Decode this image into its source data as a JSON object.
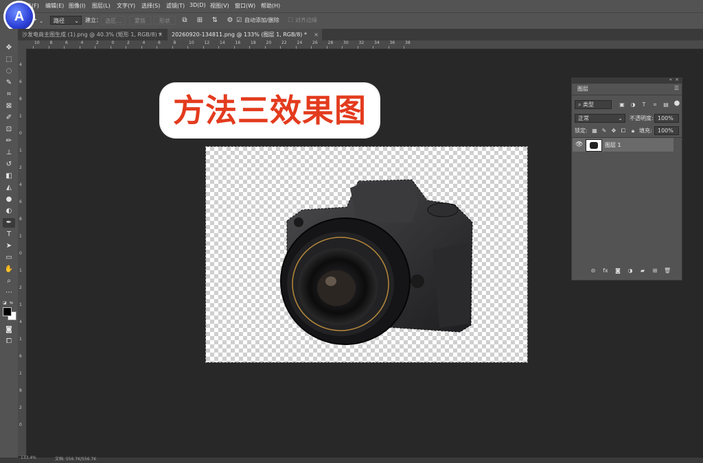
{
  "menu": [
    "文件(F)",
    "编辑(E)",
    "图像(I)",
    "图层(L)",
    "文字(Y)",
    "选择(S)",
    "滤镜(T)",
    "3D(D)",
    "视图(V)",
    "窗口(W)",
    "帮助(H)"
  ],
  "options": {
    "path_mode": "路径",
    "build_label": "建立：",
    "selection_btn": "选区...",
    "mask_btn": "蒙版",
    "shape_btn": "形状",
    "auto_add_delete": "自动添加/删除",
    "align_edges": "对齐边缘"
  },
  "tabs": [
    {
      "label": "沙发电商主图生成 (1).png @ 40.3% (矩形 1, RGB/8) *",
      "close": "×"
    },
    {
      "label": "20260920-134811.png @ 133% (图层 1, RGB/8) *",
      "close": "×"
    }
  ],
  "ruler_h": [
    "10",
    "8",
    "6",
    "4",
    "2",
    "0",
    "2",
    "4",
    "6",
    "8",
    "10",
    "12",
    "14",
    "16",
    "18",
    "20",
    "22",
    "24",
    "26",
    "28",
    "30",
    "32",
    "34",
    "36",
    "38"
  ],
  "ruler_v": [
    "4",
    "6",
    "8",
    "1",
    "0",
    "1",
    "2",
    "4",
    "6",
    "8",
    "1",
    "0",
    "1",
    "2",
    "1",
    "4",
    "1",
    "6",
    "1",
    "8",
    "2",
    "0"
  ],
  "headline": "方法三效果图",
  "layers_panel": {
    "tab": "图层",
    "filter_kind": "类型",
    "blend_mode": "正常",
    "opacity_label": "不透明度:",
    "opacity_value": "100%",
    "lock_label": "锁定:",
    "fill_label": "填充:",
    "fill_value": "100%",
    "layer_name": "图层 1"
  },
  "status": {
    "zoom": "133.4%",
    "doc": "文档: 556.7K/556.7K"
  },
  "logo_letter": "A"
}
